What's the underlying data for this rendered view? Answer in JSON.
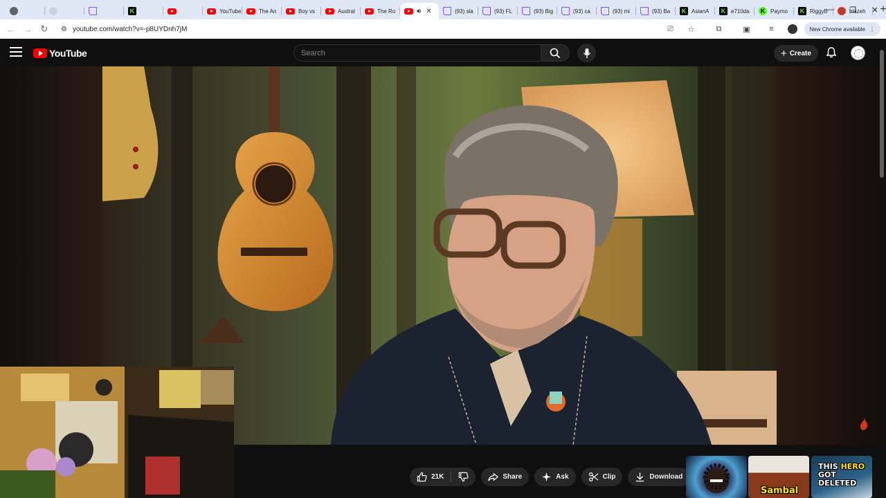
{
  "browser": {
    "tabs": [
      {
        "icon": "globe",
        "title": "",
        "active": false
      },
      {
        "icon": "blank",
        "title": "",
        "active": false
      },
      {
        "icon": "twitch",
        "title": "",
        "active": false
      },
      {
        "icon": "kick",
        "title": "",
        "active": false
      },
      {
        "icon": "youtube",
        "title": "",
        "active": false
      },
      {
        "icon": "youtube",
        "title": "YouTube",
        "active": false
      },
      {
        "icon": "youtube",
        "title": "The An",
        "active": false
      },
      {
        "icon": "youtube",
        "title": "Boy vs",
        "active": false
      },
      {
        "icon": "youtube",
        "title": "Austral",
        "active": false
      },
      {
        "icon": "youtube",
        "title": "The Ro",
        "active": false
      },
      {
        "icon": "youtube",
        "title": "",
        "active": true
      },
      {
        "icon": "twitch",
        "title": "(93) sla",
        "active": false
      },
      {
        "icon": "twitch",
        "title": "(93) FL",
        "active": false
      },
      {
        "icon": "twitch",
        "title": "(93) Big",
        "active": false
      },
      {
        "icon": "twitch",
        "title": "(93) ca",
        "active": false
      },
      {
        "icon": "twitch",
        "title": "(93) mi",
        "active": false
      },
      {
        "icon": "twitch",
        "title": "(93) Ba",
        "active": false
      },
      {
        "icon": "kick",
        "title": "AsianA",
        "active": false
      },
      {
        "icon": "kick",
        "title": "e710da",
        "active": false
      },
      {
        "icon": "kick2",
        "title": "Paymo",
        "active": false
      },
      {
        "icon": "kick",
        "title": "RiggyB",
        "active": false
      },
      {
        "icon": "blaze",
        "title": "blazeh",
        "active": false
      }
    ],
    "new_tab_label": "+",
    "window_controls": {
      "minimize": "—",
      "restore": "❐",
      "close": "✕"
    },
    "url": "youtube.com/watch?v=-p8UYDnh7jM",
    "update_label": "New Chrome available"
  },
  "youtube": {
    "logo_text": "YouTube",
    "search_placeholder": "Search",
    "create_label": "Create"
  },
  "actions": {
    "like_count": "21K",
    "share_label": "Share",
    "ask_label": "Ask",
    "clip_label": "Clip",
    "download_label": "Download",
    "more_label": "•••"
  },
  "recommendations": [
    {
      "text": ""
    },
    {
      "text": "Sambal"
    },
    {
      "text_line1_a": "THIS ",
      "text_line1_b": "HERO",
      "text_line2": "GOT DELETED"
    }
  ],
  "colors": {
    "youtube_red": "#ff0000",
    "twitch_purple": "#9146ff",
    "kick_green": "#53fc18",
    "hero_yellow": "#ffe600"
  }
}
